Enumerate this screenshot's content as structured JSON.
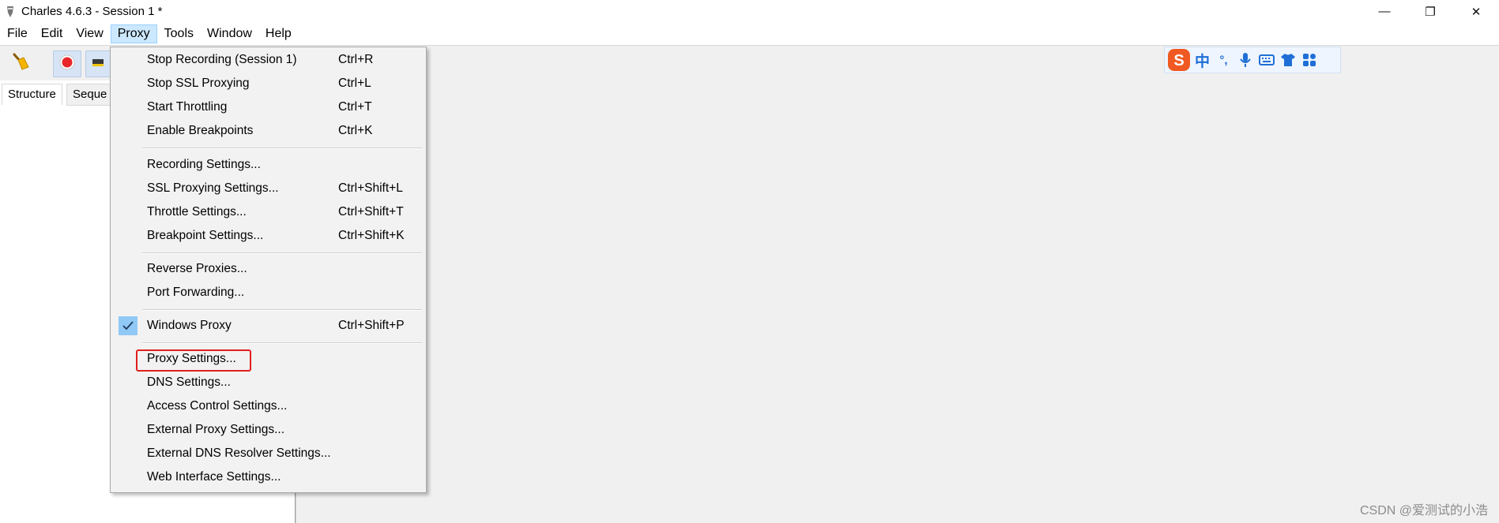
{
  "window": {
    "title": "Charles 4.6.3 - Session 1 *",
    "controls": {
      "minimize": "—",
      "restore": "❐",
      "close": "✕"
    }
  },
  "menubar": {
    "items": [
      {
        "label": "File"
      },
      {
        "label": "Edit"
      },
      {
        "label": "View"
      },
      {
        "label": "Proxy",
        "active": true
      },
      {
        "label": "Tools"
      },
      {
        "label": "Window"
      },
      {
        "label": "Help"
      }
    ]
  },
  "ime": {
    "logo": "S",
    "mode": "中",
    "punct": "°,",
    "icons": [
      "microphone-icon",
      "keyboard-icon",
      "shirt-icon",
      "grid-icon"
    ]
  },
  "left_panel": {
    "tabs": [
      {
        "label": "Structure",
        "selected": true
      },
      {
        "label": "Seque"
      }
    ]
  },
  "proxy_menu": {
    "items": [
      {
        "label": "Stop Recording (Session 1)",
        "shortcut": "Ctrl+R"
      },
      {
        "label": "Stop SSL Proxying",
        "shortcut": "Ctrl+L"
      },
      {
        "label": "Start Throttling",
        "shortcut": "Ctrl+T"
      },
      {
        "label": "Enable Breakpoints",
        "shortcut": "Ctrl+K"
      },
      {
        "label": "Recording Settings...",
        "shortcut": ""
      },
      {
        "label": "SSL Proxying Settings...",
        "shortcut": "Ctrl+Shift+L"
      },
      {
        "label": "Throttle Settings...",
        "shortcut": "Ctrl+Shift+T"
      },
      {
        "label": "Breakpoint Settings...",
        "shortcut": "Ctrl+Shift+K"
      },
      {
        "label": "Reverse Proxies...",
        "shortcut": ""
      },
      {
        "label": "Port Forwarding...",
        "shortcut": ""
      },
      {
        "label": "Windows Proxy",
        "shortcut": "Ctrl+Shift+P",
        "checked": true
      },
      {
        "label": "Proxy Settings...",
        "shortcut": "",
        "highlighted": true
      },
      {
        "label": "DNS Settings...",
        "shortcut": ""
      },
      {
        "label": "Access Control Settings...",
        "shortcut": ""
      },
      {
        "label": "External Proxy Settings...",
        "shortcut": ""
      },
      {
        "label": "External DNS Resolver Settings...",
        "shortcut": ""
      },
      {
        "label": "Web Interface Settings...",
        "shortcut": ""
      }
    ]
  },
  "watermark": "CSDN @爱测试的小浩",
  "colors": {
    "highlight": "#e0201e",
    "check_bg": "#90c8f6",
    "active_menu": "#cce8ff"
  }
}
